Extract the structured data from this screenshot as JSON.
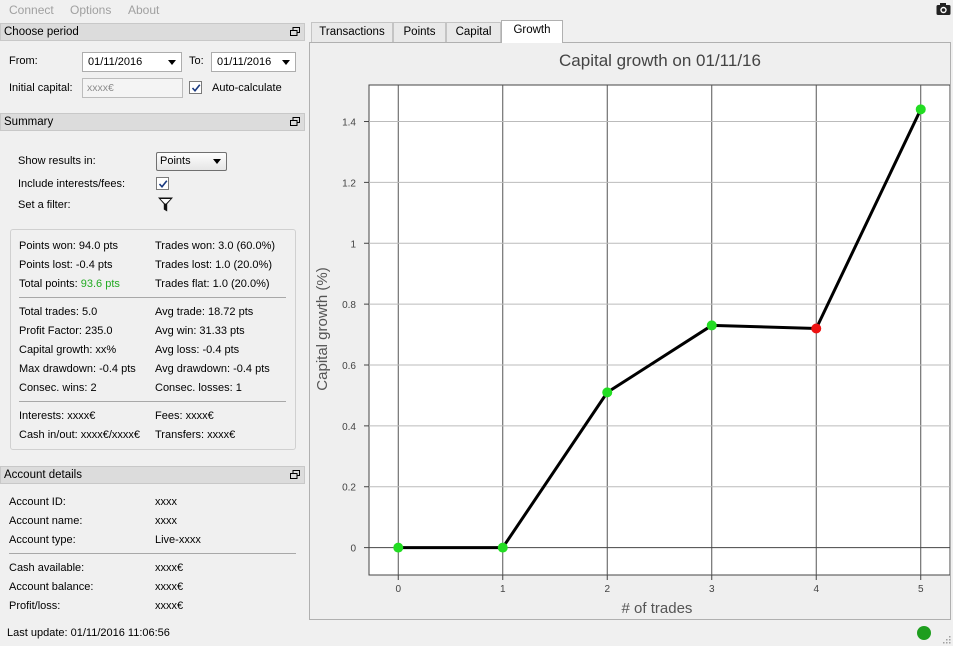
{
  "menu": {
    "items": [
      "Connect",
      "Options",
      "About"
    ]
  },
  "period": {
    "title": "Choose period",
    "from_label": "From:",
    "from_value": "01/11/2016",
    "to_label": "To:",
    "to_value": "01/11/2016",
    "initial_capital_label": "Initial capital:",
    "initial_capital_placeholder": "xxxx€",
    "auto_calc_label": "Auto-calculate",
    "auto_calc_checked": true
  },
  "summary": {
    "title": "Summary",
    "show_results_label": "Show results in:",
    "show_results_value": "Points",
    "include_fees_label": "Include interests/fees:",
    "include_fees_checked": true,
    "filter_label": "Set a filter:",
    "left": {
      "points_won": "Points won: 94.0 pts",
      "points_lost": "Points lost: -0.4 pts",
      "total_points_label": "Total points:",
      "total_points_value": "93.6 pts",
      "total_trades": "Total trades: 5.0",
      "profit_factor": "Profit Factor: 235.0",
      "capital_growth": "Capital growth: xx%",
      "max_drawdown": "Max drawdown: -0.4 pts",
      "consec_wins": "Consec. wins: 2",
      "interests": "Interests: xxxx€",
      "cash_inout": "Cash in/out: xxxx€/xxxx€"
    },
    "right": {
      "trades_won": "Trades won: 3.0 (60.0%)",
      "trades_lost": "Trades lost: 1.0 (20.0%)",
      "trades_flat": "Trades flat: 1.0 (20.0%)",
      "avg_trade": "Avg trade: 18.72 pts",
      "avg_win": "Avg win: 31.33 pts",
      "avg_loss": "Avg loss: -0.4 pts",
      "avg_drawdown": "Avg drawdown: -0.4 pts",
      "consec_losses": "Consec. losses: 1",
      "fees": "Fees: xxxx€",
      "transfers": "Transfers: xxxx€"
    },
    "total_points_color": "#22aa22"
  },
  "account": {
    "title": "Account details",
    "rows": [
      {
        "label": "Account ID:",
        "value": "xxxx"
      },
      {
        "label": "Account name:",
        "value": "xxxx"
      },
      {
        "label": "Account type:",
        "value": "Live-xxxx"
      },
      {
        "label": "Cash available:",
        "value": "xxxx€"
      },
      {
        "label": "Account balance:",
        "value": "xxxx€"
      },
      {
        "label": "Profit/loss:",
        "value": "xxxx€"
      }
    ]
  },
  "tabs": [
    "Transactions",
    "Points",
    "Capital",
    "Growth"
  ],
  "active_tab": "Growth",
  "status": {
    "last_update": "Last update: 01/11/2016 11:06:56",
    "led_color": "#1e9e1e"
  },
  "chart_data": {
    "type": "line",
    "title": "Capital growth on 01/11/16",
    "xlabel": "# of trades",
    "ylabel": "Capital growth (%)",
    "x": [
      0,
      1,
      2,
      3,
      4,
      5
    ],
    "y": [
      0,
      0,
      0.51,
      0.73,
      0.72,
      1.44
    ],
    "point_colors": [
      "#22dd22",
      "#22dd22",
      "#22dd22",
      "#22dd22",
      "#ee1111",
      "#22dd22"
    ],
    "xticks": [
      "0",
      "1",
      "2",
      "3",
      "4",
      "5"
    ],
    "yticks": [
      "0",
      "0.2",
      "0.4",
      "0.6",
      "0.8",
      "1",
      "1.2",
      "1.4"
    ],
    "xlim": [
      -0.28,
      5.28
    ],
    "ylim": [
      -0.09,
      1.52
    ],
    "grid": true,
    "line_color": "#000000"
  }
}
